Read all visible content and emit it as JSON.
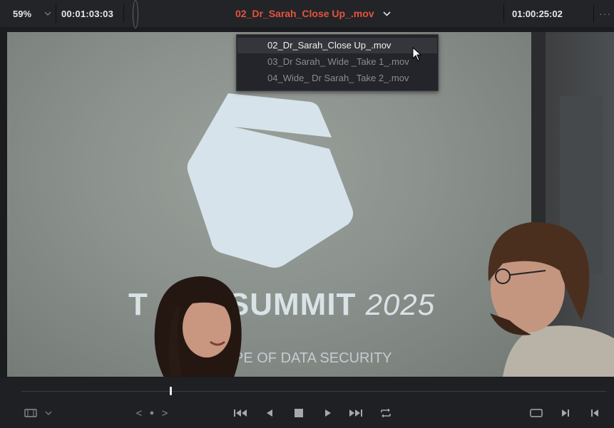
{
  "viewer": {
    "zoom": "59%",
    "source_timecode": "00:01:03:03",
    "clip_name": "02_Dr_Sarah_Close Up_.mov",
    "record_timecode": "01:00:25:02",
    "more_label": "···"
  },
  "clip_menu": {
    "items": [
      {
        "label": "02_Dr_Sarah_Close Up_.mov",
        "selected": true
      },
      {
        "label": "03_Dr Sarah_ Wide _Take 1_.mov",
        "selected": false
      },
      {
        "label": "04_Wide_ Dr Sarah_ Take 2_.mov",
        "selected": false
      }
    ]
  },
  "frame": {
    "title_left": "T",
    "title_mid": "SUMMIT",
    "title_year": "2025",
    "subtitle": "PE OF DATA SECURITY"
  },
  "transport": {
    "prev_label": "<",
    "dot_label": "●",
    "next_label": ">",
    "playhead_progress": 0.255
  },
  "colors": {
    "accent_red": "#e5533d",
    "toolbar_bg": "#232428",
    "menu_bg": "#24252a",
    "menu_selected_bg": "#35363b"
  },
  "icons": [
    "chevron-down-icon",
    "go-to-first-frame-icon",
    "step-back-icon",
    "stop-icon",
    "play-icon",
    "go-to-last-frame-icon",
    "loop-icon",
    "display-mode-icon",
    "match-frame-icon",
    "next-edit-icon",
    "prev-edit-icon"
  ]
}
